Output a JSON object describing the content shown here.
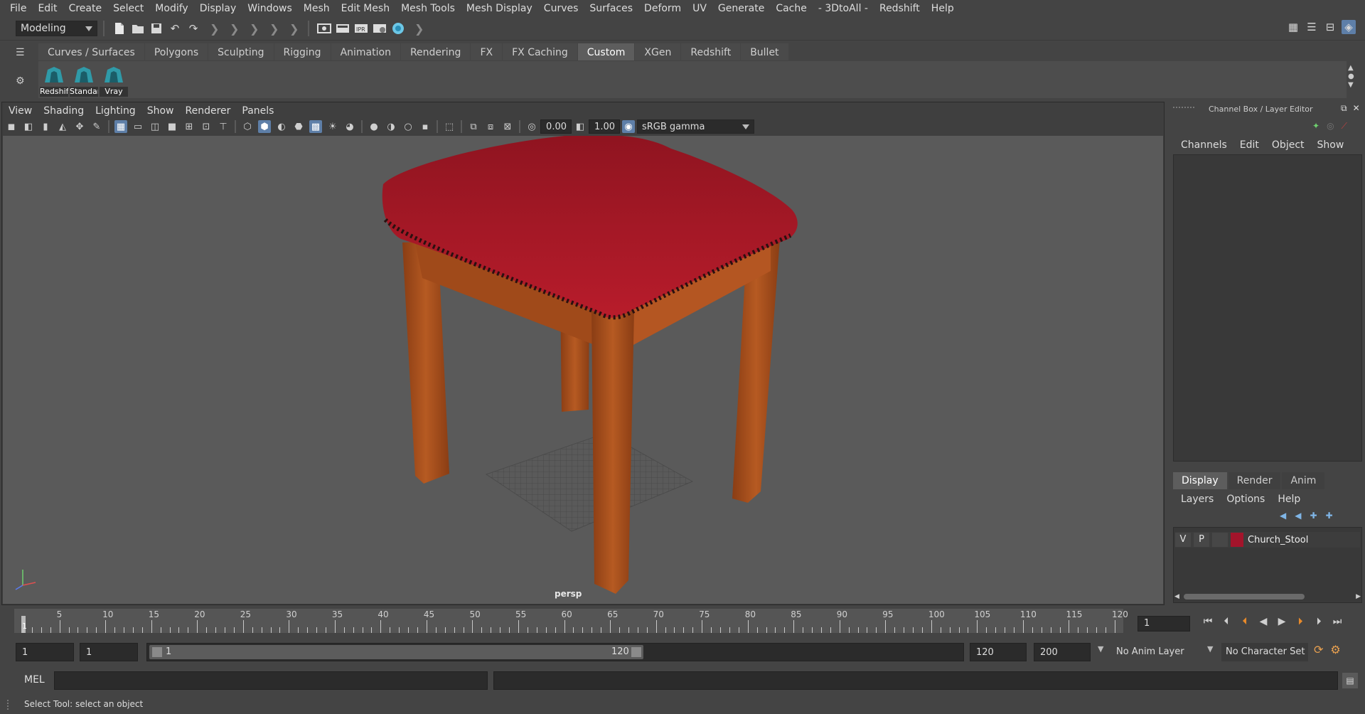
{
  "menubar": {
    "items": [
      "File",
      "Edit",
      "Create",
      "Select",
      "Modify",
      "Display",
      "Windows",
      "Mesh",
      "Edit Mesh",
      "Mesh Tools",
      "Mesh Display",
      "Curves",
      "Surfaces",
      "Deform",
      "UV",
      "Generate",
      "Cache",
      "- 3DtoAll -",
      "Redshift",
      "Help"
    ]
  },
  "statusline": {
    "menuset": "Modeling"
  },
  "shelf": {
    "tabs": [
      "Curves / Surfaces",
      "Polygons",
      "Sculpting",
      "Rigging",
      "Animation",
      "Rendering",
      "FX",
      "FX Caching",
      "Custom",
      "XGen",
      "Redshift",
      "Bullet"
    ],
    "active_tab": "Custom",
    "buttons": [
      "Redshif",
      "Standar",
      "Vray"
    ]
  },
  "viewport": {
    "menu": [
      "View",
      "Shading",
      "Lighting",
      "Show",
      "Renderer",
      "Panels"
    ],
    "exposure": "0.00",
    "gamma": "1.00",
    "color_space": "sRGB gamma",
    "camera_label": "persp"
  },
  "channel_box": {
    "title": "Channel Box / Layer Editor",
    "menu": [
      "Channels",
      "Edit",
      "Object",
      "Show"
    ]
  },
  "layer_editor": {
    "tabs": [
      "Display",
      "Render",
      "Anim"
    ],
    "active_tab": "Display",
    "menu": [
      "Layers",
      "Options",
      "Help"
    ],
    "layer": {
      "visible": "V",
      "playback": "P",
      "color": "#a3142b",
      "name": "Church_Stool"
    }
  },
  "timeslider": {
    "ticks": [
      "5",
      "10",
      "15",
      "20",
      "25",
      "30",
      "35",
      "40",
      "45",
      "50",
      "55",
      "60",
      "65",
      "70",
      "75",
      "80",
      "85",
      "90",
      "95",
      "100",
      "105",
      "110",
      "115",
      "120"
    ],
    "current_frame_marker": "1",
    "current_frame_field": "1"
  },
  "range": {
    "start_outer": "1",
    "start_inner": "1",
    "slider_start": "1",
    "slider_end": "120",
    "end_inner": "120",
    "end_outer": "200",
    "anim_layer": "No Anim Layer",
    "character_set": "No Character Set"
  },
  "command_line": {
    "label": "MEL"
  },
  "help_line": {
    "text": "Select Tool: select an object"
  }
}
